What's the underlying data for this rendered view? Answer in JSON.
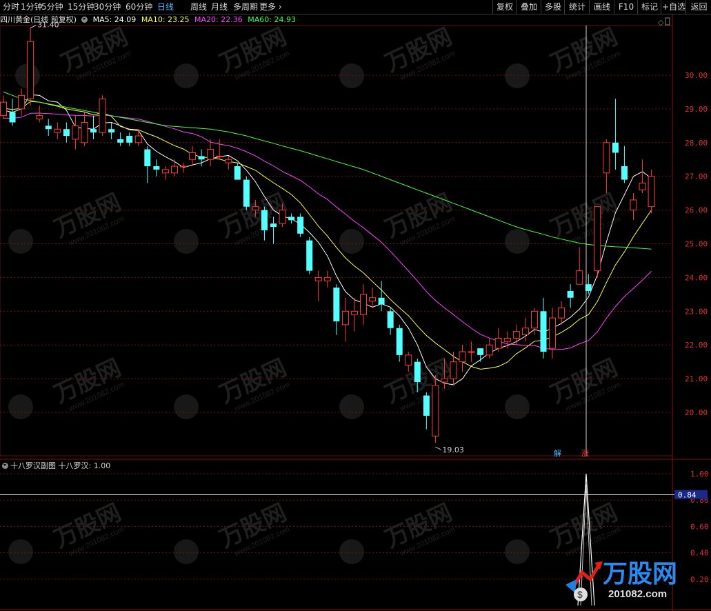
{
  "toolbar": {
    "periods": [
      "分时",
      "1分钟",
      "5分钟",
      "15分钟",
      "30分钟",
      "60分钟",
      "日线",
      "周线",
      "月线",
      "多周期",
      "更多"
    ],
    "active_period": "日线",
    "right_buttons": [
      "复权",
      "叠加",
      "多股",
      "统计",
      "画线",
      "F10",
      "标记",
      "+自选",
      "返回"
    ]
  },
  "info": {
    "title": "四川黄金(日线 前复权)",
    "ma5": "MA5: 24.09",
    "ma10": "MA10: 23.25",
    "ma20": "MA20: 22.36",
    "ma60": "MA60: 24.93",
    "colors": {
      "ma5": "#ffffff",
      "ma10": "#ffff40",
      "ma20": "#ff40ff",
      "ma60": "#40ff40"
    }
  },
  "sub": {
    "title": "十八罗汉副图",
    "value": "十八罗汉: 1.00",
    "current": "0.84"
  },
  "markers": {
    "high": "31.40",
    "low": "19.03",
    "jie": "解",
    "zhang": "涨"
  },
  "watermark": {
    "brand": "万股网",
    "url": "www.201082.com"
  },
  "chart_data": {
    "type": "candlestick",
    "y_ticks": [
      "30.00",
      "29.00",
      "28.00",
      "27.00",
      "26.00",
      "25.00",
      "24.00",
      "23.00",
      "22.00",
      "21.00",
      "20.00"
    ],
    "sub_ticks": [
      "1.00",
      "0.80",
      "0.60",
      "0.40",
      "0.20"
    ],
    "ylim": [
      19.0,
      31.5
    ],
    "candles": [
      [
        28.8,
        29.2,
        29.4,
        28.7
      ],
      [
        28.9,
        28.6,
        29.3,
        28.5
      ],
      [
        29.0,
        29.4,
        29.6,
        28.8
      ],
      [
        29.3,
        31.0,
        31.4,
        29.1
      ],
      [
        28.7,
        28.8,
        29.1,
        28.6
      ],
      [
        28.5,
        28.4,
        28.7,
        28.2
      ],
      [
        28.3,
        28.4,
        28.6,
        28.1
      ],
      [
        28.4,
        28.2,
        28.6,
        28.0
      ],
      [
        28.1,
        28.5,
        28.8,
        27.8
      ],
      [
        28.0,
        28.6,
        28.9,
        27.9
      ],
      [
        28.4,
        28.3,
        28.8,
        28.1
      ],
      [
        28.3,
        29.3,
        29.4,
        28.2
      ],
      [
        28.4,
        28.3,
        28.6,
        28.1
      ],
      [
        28.1,
        28.0,
        28.3,
        27.9
      ],
      [
        28.2,
        28.0,
        28.3,
        27.9
      ],
      [
        28.0,
        28.2,
        28.4,
        27.9
      ],
      [
        27.8,
        27.3,
        27.9,
        26.8
      ],
      [
        27.3,
        27.2,
        27.5,
        27.0
      ],
      [
        27.1,
        27.2,
        27.3,
        26.9
      ],
      [
        27.1,
        27.3,
        27.5,
        27.0
      ],
      [
        27.3,
        27.3,
        27.4,
        27.1
      ],
      [
        27.5,
        27.7,
        27.9,
        27.3
      ],
      [
        27.6,
        27.5,
        27.8,
        27.3
      ],
      [
        27.5,
        27.8,
        28.1,
        27.3
      ],
      [
        27.6,
        27.6,
        28.1,
        27.5
      ],
      [
        27.4,
        27.5,
        27.6,
        27.2
      ],
      [
        27.3,
        26.9,
        27.4,
        26.9
      ],
      [
        26.9,
        26.1,
        27.0,
        26.0
      ],
      [
        26.0,
        26.1,
        26.3,
        25.8
      ],
      [
        26.0,
        25.4,
        26.1,
        25.1
      ],
      [
        25.6,
        25.5,
        25.8,
        25.0
      ],
      [
        25.6,
        26.0,
        26.2,
        25.5
      ],
      [
        25.8,
        25.7,
        25.9,
        25.6
      ],
      [
        25.8,
        25.3,
        25.9,
        25.2
      ],
      [
        25.1,
        24.2,
        25.2,
        24.1
      ],
      [
        23.9,
        24.0,
        24.2,
        23.3
      ],
      [
        23.9,
        24.0,
        24.2,
        23.7
      ],
      [
        23.7,
        22.7,
        23.8,
        22.3
      ],
      [
        22.6,
        23.0,
        23.4,
        22.1
      ],
      [
        22.9,
        23.0,
        23.4,
        22.4
      ],
      [
        22.9,
        23.5,
        23.8,
        22.6
      ],
      [
        23.3,
        23.4,
        23.7,
        23.1
      ],
      [
        23.4,
        23.2,
        23.9,
        23.0
      ],
      [
        23.0,
        22.5,
        23.1,
        22.3
      ],
      [
        22.5,
        21.7,
        22.6,
        21.5
      ],
      [
        21.4,
        21.7,
        21.8,
        21.2
      ],
      [
        21.5,
        20.9,
        21.6,
        20.6
      ],
      [
        20.5,
        19.9,
        20.6,
        19.5
      ],
      [
        19.3,
        20.8,
        21.1,
        19.1
      ],
      [
        20.9,
        21.0,
        21.6,
        20.7
      ],
      [
        21.0,
        21.5,
        21.8,
        20.8
      ],
      [
        21.5,
        21.8,
        22.0,
        21.2
      ],
      [
        21.8,
        21.8,
        22.1,
        21.5
      ],
      [
        21.9,
        21.7,
        21.9,
        21.5
      ],
      [
        21.7,
        22.0,
        22.2,
        21.6
      ],
      [
        21.9,
        22.2,
        22.5,
        21.8
      ],
      [
        22.1,
        22.2,
        22.4,
        21.9
      ],
      [
        22.2,
        22.4,
        22.6,
        22.0
      ],
      [
        22.3,
        22.5,
        22.8,
        22.1
      ],
      [
        22.5,
        23.0,
        23.1,
        22.3
      ],
      [
        23.0,
        21.8,
        23.4,
        21.6
      ],
      [
        21.9,
        22.8,
        23.1,
        21.6
      ],
      [
        22.8,
        23.1,
        23.3,
        22.6
      ],
      [
        23.6,
        23.4,
        23.8,
        23.1
      ],
      [
        23.8,
        24.2,
        24.9,
        23.8
      ],
      [
        23.8,
        23.6,
        24.1,
        23.5
      ],
      [
        24.2,
        26.1,
        26.1,
        24.0
      ],
      [
        27.1,
        28.0,
        28.1,
        26.5
      ],
      [
        28.0,
        27.7,
        29.3,
        27.2
      ],
      [
        27.3,
        26.9,
        27.9,
        26.8
      ],
      [
        26.0,
        26.3,
        26.5,
        25.7
      ],
      [
        26.6,
        26.8,
        27.5,
        26.5
      ],
      [
        26.1,
        27.0,
        27.2,
        25.9
      ]
    ],
    "ma60": [
      29.5,
      29.4,
      29.3,
      29.25,
      29.2,
      29.15,
      29.1,
      29.05,
      29.0,
      28.95,
      28.9,
      28.85,
      28.8,
      28.75,
      28.7,
      28.65,
      28.6,
      28.55,
      28.5,
      28.48,
      28.46,
      28.44,
      28.42,
      28.4,
      28.36,
      28.32,
      28.26,
      28.2,
      28.12,
      28.05,
      27.98,
      27.9,
      27.83,
      27.76,
      27.68,
      27.6,
      27.52,
      27.44,
      27.36,
      27.28,
      27.2,
      27.1,
      27.0,
      26.9,
      26.8,
      26.7,
      26.6,
      26.5,
      26.4,
      26.3,
      26.2,
      26.1,
      26.0,
      25.9,
      25.8,
      25.7,
      25.6,
      25.5,
      25.42,
      25.35,
      25.28,
      25.2,
      25.14,
      25.08,
      25.02,
      24.98,
      24.95,
      24.93,
      24.91,
      24.9,
      24.88,
      24.86,
      24.84
    ]
  }
}
